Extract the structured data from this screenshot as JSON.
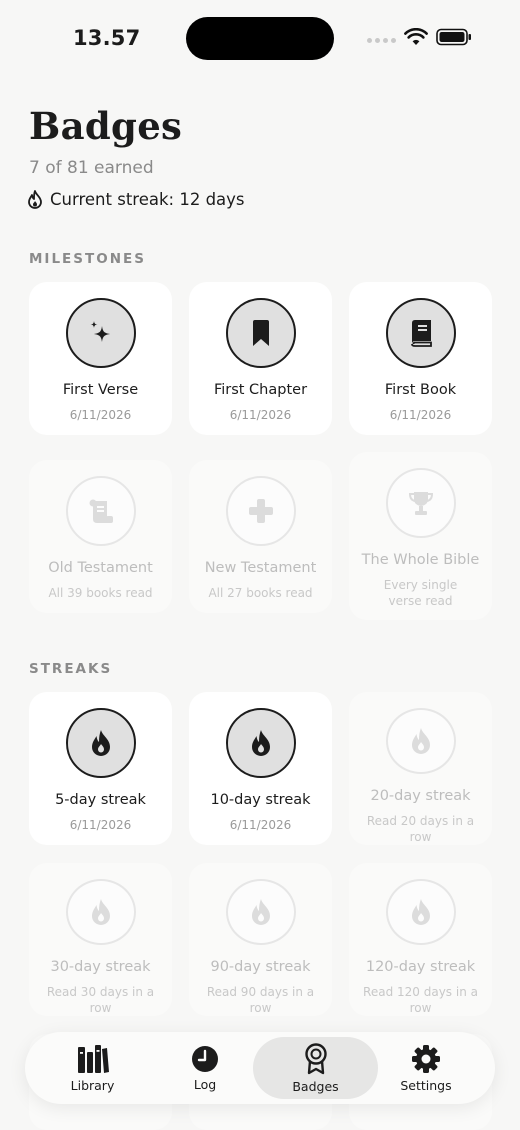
{
  "status": {
    "time": "13.57"
  },
  "header": {
    "title": "Badges",
    "subtitle": "7 of 81 earned",
    "streak": "Current streak: 12 days"
  },
  "sections": {
    "milestones": {
      "label": "MILESTONES",
      "cards": [
        {
          "name": "First Verse",
          "sub": "6/11/2026",
          "earned": true,
          "icon": "sparkle-icon"
        },
        {
          "name": "First Chapter",
          "sub": "6/11/2026",
          "earned": true,
          "icon": "bookmark-icon"
        },
        {
          "name": "First Book",
          "sub": "6/11/2026",
          "earned": true,
          "icon": "book-icon"
        },
        {
          "name": "Old Testament",
          "sub": "All 39 books read",
          "earned": false,
          "icon": "scroll-icon"
        },
        {
          "name": "New Testament",
          "sub": "All 27 books read",
          "earned": false,
          "icon": "cross-icon"
        },
        {
          "name": "The Whole Bible",
          "sub": "Every single verse read",
          "earned": false,
          "icon": "trophy-icon"
        }
      ]
    },
    "streaks": {
      "label": "STREAKS",
      "cards": [
        {
          "name": "5-day streak",
          "sub": "6/11/2026",
          "earned": true,
          "icon": "flame-icon"
        },
        {
          "name": "10-day streak",
          "sub": "6/11/2026",
          "earned": true,
          "icon": "flame-icon"
        },
        {
          "name": "20-day streak",
          "sub": "Read 20 days in a row",
          "earned": false,
          "icon": "flame-icon"
        },
        {
          "name": "30-day streak",
          "sub": "Read 30 days in a row",
          "earned": false,
          "icon": "flame-icon"
        },
        {
          "name": "90-day streak",
          "sub": "Read 90 days in a row",
          "earned": false,
          "icon": "flame-icon"
        },
        {
          "name": "120-day streak",
          "sub": "Read 120 days in a row",
          "earned": false,
          "icon": "flame-icon"
        }
      ]
    }
  },
  "tabbar": {
    "items": [
      {
        "label": "Library",
        "icon": "library-icon"
      },
      {
        "label": "Log",
        "icon": "clock-icon"
      },
      {
        "label": "Badges",
        "icon": "badge-icon",
        "active": true
      },
      {
        "label": "Settings",
        "icon": "gear-icon"
      }
    ]
  },
  "colors": {
    "text": "#1c1c1c",
    "muted": "#8a8a8a",
    "locked": "#bdbdbd",
    "earned_fill": "#e0e0e0"
  }
}
